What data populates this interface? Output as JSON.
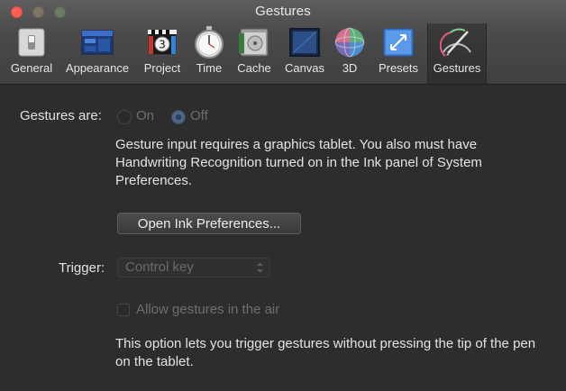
{
  "window": {
    "title": "Gestures"
  },
  "toolbar": {
    "items": [
      {
        "label": "General",
        "icon": "general-switch-icon"
      },
      {
        "label": "Appearance",
        "icon": "appearance-window-icon"
      },
      {
        "label": "Project",
        "icon": "project-clapper-icon"
      },
      {
        "label": "Time",
        "icon": "time-stopwatch-icon"
      },
      {
        "label": "Cache",
        "icon": "cache-memory-icon"
      },
      {
        "label": "Canvas",
        "icon": "canvas-frame-icon"
      },
      {
        "label": "3D",
        "icon": "3d-sphere-icon"
      },
      {
        "label": "Presets",
        "icon": "presets-icon"
      },
      {
        "label": "Gestures",
        "icon": "gestures-pen-icon"
      }
    ],
    "selected": "Gestures"
  },
  "gestures": {
    "label": "Gestures are:",
    "options": [
      {
        "label": "On",
        "selected": false
      },
      {
        "label": "Off",
        "selected": true
      }
    ],
    "enabled": false
  },
  "info_text": "Gesture input requires a graphics tablet. You also must have Handwriting Recognition turned on in the Ink panel of System Preferences.",
  "open_ink_button": "Open Ink Preferences...",
  "trigger": {
    "label": "Trigger:",
    "value": "Control key",
    "enabled": false
  },
  "allow_air": {
    "label": "Allow gestures in the air",
    "checked": false,
    "enabled": false
  },
  "option_text": "This option lets you trigger gestures without pressing the tip of the pen on the tablet.",
  "colors": {
    "close": "#fc5f57",
    "selected_radio": "#3f5678",
    "background": "#2d2d2d"
  }
}
